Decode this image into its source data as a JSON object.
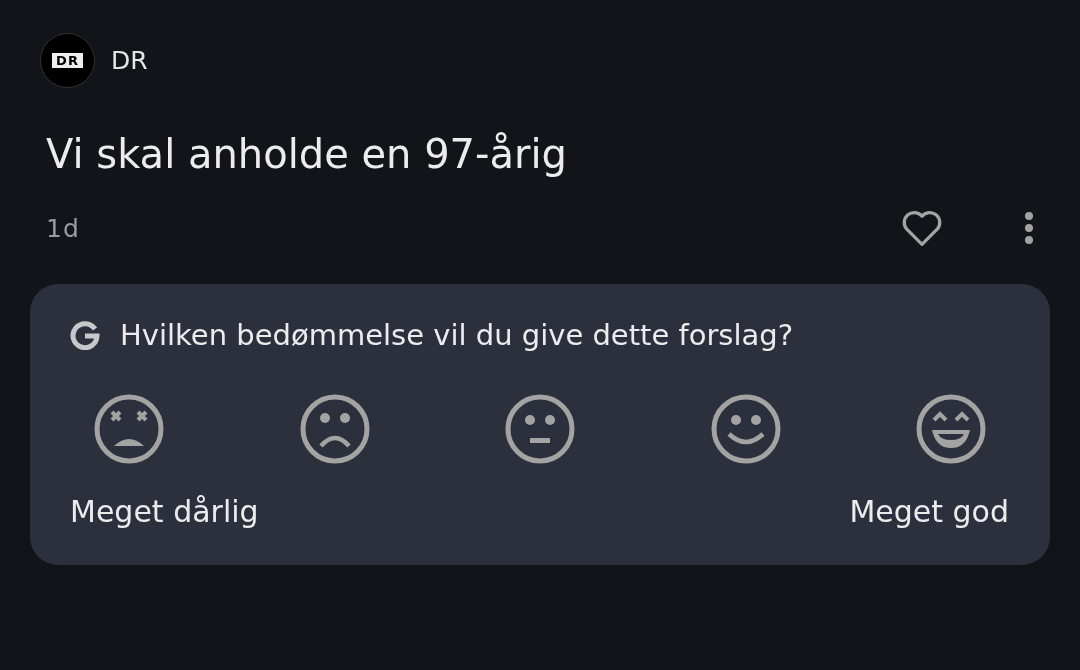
{
  "source": {
    "logo_text": "DR",
    "name": "DR"
  },
  "headline": "Vi skal anholde en 97-årig",
  "age": "1d",
  "liked": false,
  "rating_card": {
    "question": "Hvilken bedømmelse vil du give dette forslag?",
    "options": [
      {
        "kind": "very_bad"
      },
      {
        "kind": "bad"
      },
      {
        "kind": "neutral"
      },
      {
        "kind": "good"
      },
      {
        "kind": "very_good"
      }
    ],
    "low_label": "Meget dårlig",
    "high_label": "Meget god"
  }
}
